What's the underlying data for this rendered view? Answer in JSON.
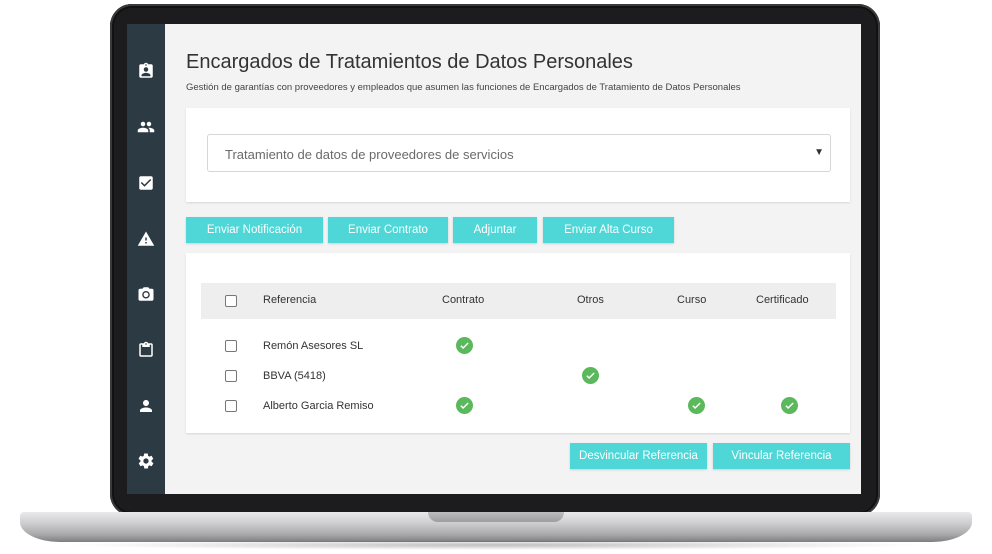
{
  "app": {
    "title": "Encargados de Tratamientos de Datos Personales",
    "subtitle": "Gestión de garantías con proveedores y empleados que asumen las funciones de Encargados de Tratamiento de Datos Personales"
  },
  "sidebar": {
    "items": [
      {
        "icon": "badge-icon"
      },
      {
        "icon": "people-icon"
      },
      {
        "icon": "check-box-icon"
      },
      {
        "icon": "warning-icon"
      },
      {
        "icon": "camera-icon"
      },
      {
        "icon": "clipboard-icon"
      },
      {
        "icon": "person-icon"
      },
      {
        "icon": "gear-icon"
      }
    ]
  },
  "select": {
    "value": "Tratamiento de datos de proveedores de servicios",
    "arrow": "▼"
  },
  "actions": {
    "notify": "Enviar Notificación",
    "contract": "Enviar Contrato",
    "attach": "Adjuntar",
    "course": "Enviar Alta Curso"
  },
  "table": {
    "headers": {
      "reference": "Referencia",
      "contract": "Contrato",
      "other": "Otros",
      "course": "Curso",
      "certificate": "Certificado"
    },
    "rows": [
      {
        "name": "Remón Asesores SL",
        "contract": true,
        "other": false,
        "course": false,
        "certificate": false
      },
      {
        "name": "BBVA (5418)",
        "contract": false,
        "other": true,
        "course": false,
        "certificate": false
      },
      {
        "name": "Alberto Garcia Remiso",
        "contract": true,
        "other": false,
        "course": true,
        "certificate": true
      }
    ]
  },
  "footer": {
    "unlink": "Desvincular Referencia",
    "link": "Vincular Referencia"
  },
  "colors": {
    "sidebar": "#2c3a44",
    "accent": "#4fd6d6",
    "check": "#5cb85c"
  }
}
